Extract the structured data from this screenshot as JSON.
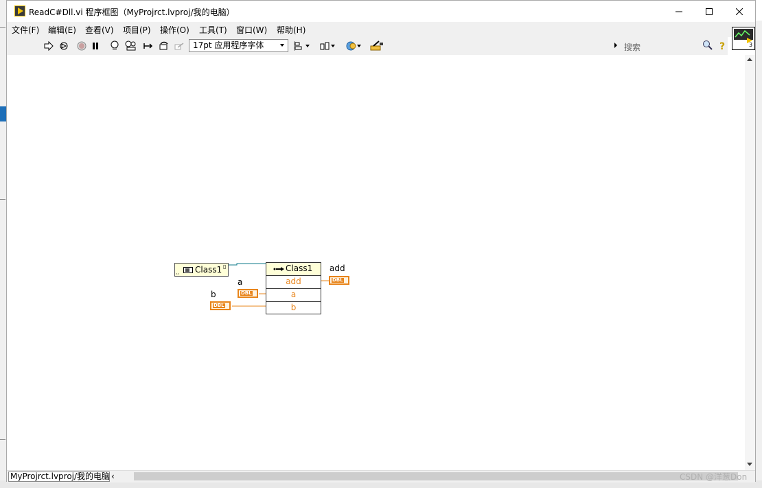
{
  "window": {
    "title": "ReadC#Dll.vi 程序框图（MyProjrct.lvproj/我的电脑）"
  },
  "menu": [
    "文件(F)",
    "编辑(E)",
    "查看(V)",
    "项目(P)",
    "操作(O)",
    "工具(T)",
    "窗口(W)",
    "帮助(H)"
  ],
  "toolbar": {
    "font": "17pt 应用程序字体",
    "search_placeholder": "搜索"
  },
  "connector_pane_number": "3",
  "diagram": {
    "constructor_label": "Class1",
    "property_node": {
      "class_label": "Class1",
      "rows": [
        "add",
        "a",
        "b"
      ]
    },
    "labels": {
      "a": "a",
      "b": "b",
      "add": "add"
    },
    "dbl_text": "DBL",
    "colors": {
      "numeric_orange": "#e8841a",
      "refnum_teal": "#0c7a8a",
      "node_yellow": "#ffffd8"
    }
  },
  "status": {
    "context": "MyProjrct.lvproj/我的电脑"
  },
  "watermark": "CSDN @洋葱Don"
}
